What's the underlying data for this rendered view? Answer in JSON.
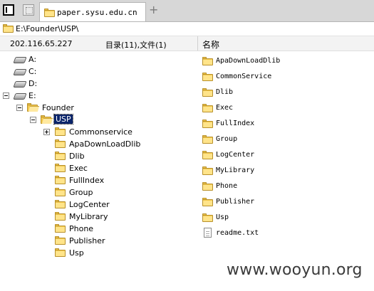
{
  "tabbar": {
    "tab_title": "paper.sysu.edu.cn",
    "new_tab": "+"
  },
  "pathbar": {
    "path": "E:\\Founder\\USP\\"
  },
  "header": {
    "ip": "202.116.65.227",
    "summary": "目录(11),文件(1)",
    "column_name": "名称"
  },
  "tree": {
    "drives": [
      "A:",
      "C:",
      "D:",
      "E:"
    ],
    "founder": "Founder",
    "usp": "USP",
    "children": [
      "Commonservice",
      "ApaDownLoadDlib",
      "Dlib",
      "Exec",
      "FullIndex",
      "Group",
      "LogCenter",
      "MyLibrary",
      "Phone",
      "Publisher",
      "Usp"
    ]
  },
  "files": {
    "folders": [
      "ApaDownLoadDlib",
      "CommonService",
      "Dlib",
      "Exec",
      "FullIndex",
      "Group",
      "LogCenter",
      "MyLibrary",
      "Phone",
      "Publisher",
      "Usp"
    ],
    "docs": [
      "readme.txt"
    ]
  },
  "watermark": "www.wooyun.org"
}
